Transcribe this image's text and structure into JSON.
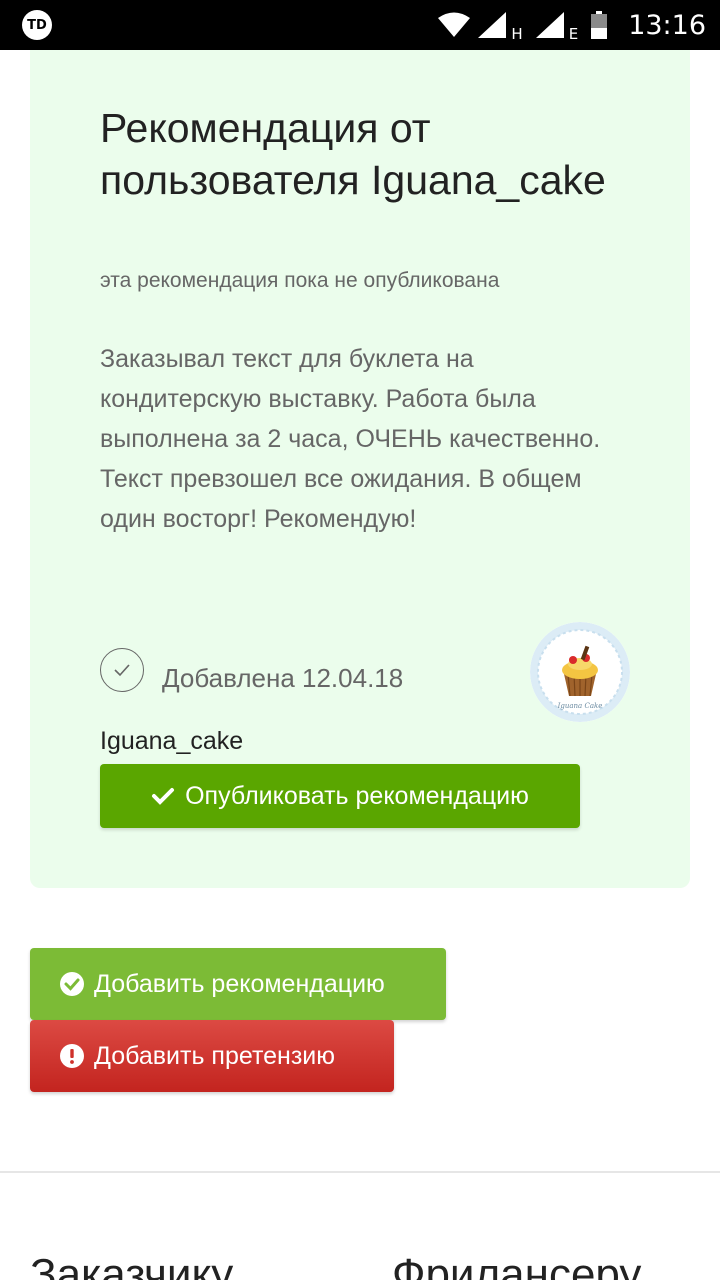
{
  "status_bar": {
    "app_badge": "TD",
    "network_1": "H",
    "network_2": "E",
    "time": "13:16"
  },
  "recommendation": {
    "title": "Рекомендация от пользователя Iguana_cake",
    "note": "эта рекомендация пока не опубликована",
    "text": "Заказывал текст для буклета на кондитерскую выставку. Работа была выполнена за 2 часа, ОЧЕНЬ качественно. Текст превзошел все ожидания. В общем один восторг! Рекомендую!",
    "added": "Добавлена 12.04.18",
    "author": "Iguana_cake",
    "avatar_caption": "Iguana Cake",
    "publish_label": "Опубликовать рекомендацию"
  },
  "actions": {
    "add_recommendation_label": "Добавить рекомендацию",
    "add_claim_label": "Добавить претензию"
  },
  "footer": {
    "col1_heading": "Заказчику",
    "col2_heading": "Фрилансеру"
  },
  "colors": {
    "card_bg": "#ebfdec",
    "publish_green": "#5aa600",
    "add_green": "#7cbb36",
    "claim_red": "#d03630"
  },
  "icons": {
    "app": "td-app-icon",
    "wifi": "wifi-icon",
    "signal": "signal-icon",
    "battery": "battery-icon",
    "added_status": "checkmark-circle-icon",
    "publish": "checkmark-icon",
    "add_recommendation": "check-circle-icon",
    "add_claim": "exclamation-circle-icon"
  }
}
